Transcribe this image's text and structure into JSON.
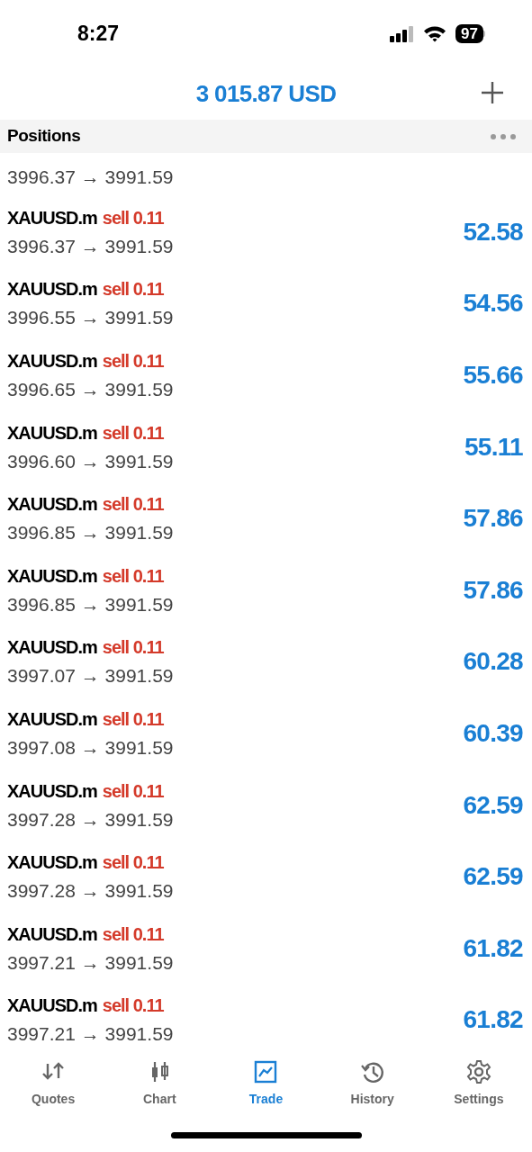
{
  "status_bar": {
    "time": "8:27",
    "battery": "97"
  },
  "header": {
    "balance": "3 015.87 USD"
  },
  "section": {
    "title": "Positions"
  },
  "positions": [
    {
      "prices": "3996.37 → 3991.59"
    },
    {
      "symbol": "XAUUSD.m",
      "order": "sell 0.11",
      "prices": "3996.37 → 3991.59",
      "profit": "52.58"
    },
    {
      "symbol": "XAUUSD.m",
      "order": "sell 0.11",
      "prices": "3996.55 → 3991.59",
      "profit": "54.56"
    },
    {
      "symbol": "XAUUSD.m",
      "order": "sell 0.11",
      "prices": "3996.65 → 3991.59",
      "profit": "55.66"
    },
    {
      "symbol": "XAUUSD.m",
      "order": "sell 0.11",
      "prices": "3996.60 → 3991.59",
      "profit": "55.11"
    },
    {
      "symbol": "XAUUSD.m",
      "order": "sell 0.11",
      "prices": "3996.85 → 3991.59",
      "profit": "57.86"
    },
    {
      "symbol": "XAUUSD.m",
      "order": "sell 0.11",
      "prices": "3996.85 → 3991.59",
      "profit": "57.86"
    },
    {
      "symbol": "XAUUSD.m",
      "order": "sell 0.11",
      "prices": "3997.07 → 3991.59",
      "profit": "60.28"
    },
    {
      "symbol": "XAUUSD.m",
      "order": "sell 0.11",
      "prices": "3997.08 → 3991.59",
      "profit": "60.39"
    },
    {
      "symbol": "XAUUSD.m",
      "order": "sell 0.11",
      "prices": "3997.28 → 3991.59",
      "profit": "62.59"
    },
    {
      "symbol": "XAUUSD.m",
      "order": "sell 0.11",
      "prices": "3997.28 → 3991.59",
      "profit": "62.59"
    },
    {
      "symbol": "XAUUSD.m",
      "order": "sell 0.11",
      "prices": "3997.21 → 3991.59",
      "profit": "61.82"
    },
    {
      "symbol": "XAUUSD.m",
      "order": "sell 0.11",
      "prices": "3997.21 → 3991.59",
      "profit": "61.82"
    }
  ],
  "tabs": [
    {
      "kind": "quotes",
      "label": "Quotes",
      "selected": false
    },
    {
      "kind": "chart",
      "label": "Chart",
      "selected": false
    },
    {
      "kind": "trade",
      "label": "Trade",
      "selected": true
    },
    {
      "kind": "history",
      "label": "History",
      "selected": false
    },
    {
      "kind": "settings",
      "label": "Settings",
      "selected": false
    }
  ]
}
